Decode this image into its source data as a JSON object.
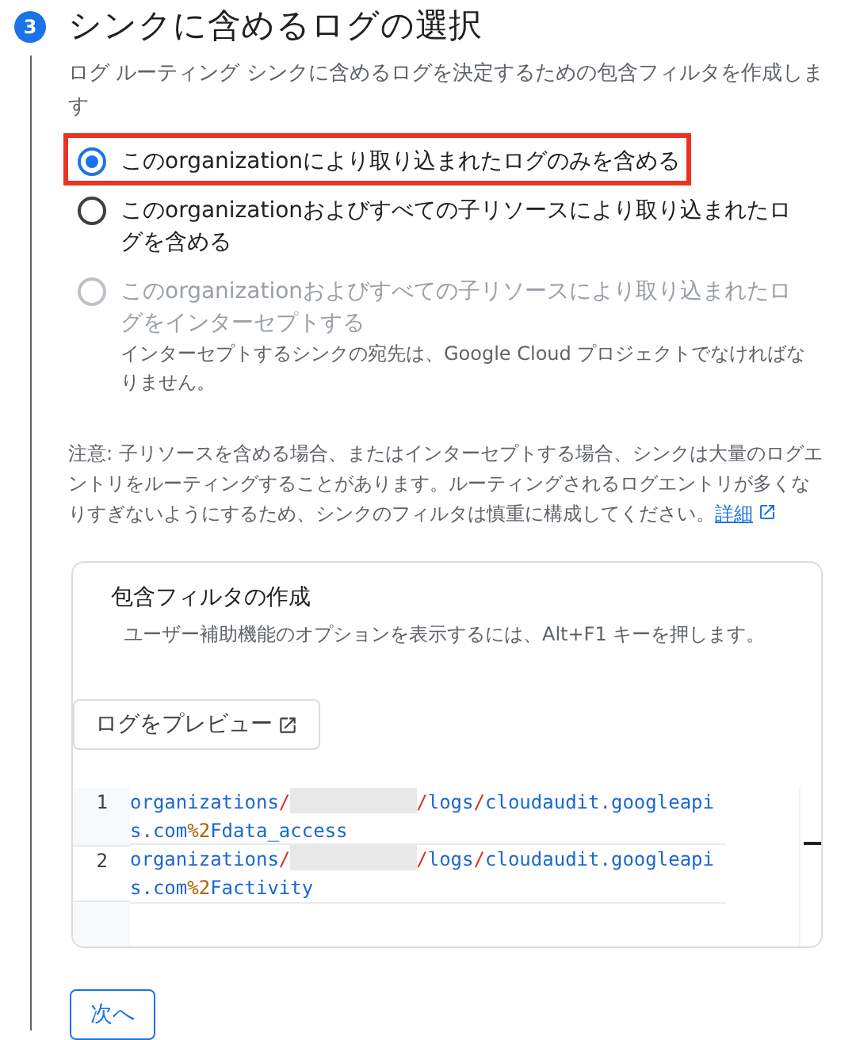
{
  "step": {
    "number": "3",
    "title": "シンクに含めるログの選択",
    "description": "ログ ルーティング シンクに含めるログを決定するための包含フィルタを作成します"
  },
  "options": [
    {
      "label": "このorganizationにより取り込まれたログのみを含める",
      "selected": true,
      "disabled": false,
      "highlighted": true
    },
    {
      "label": "このorganizationおよびすべての子リソースにより取り込まれたログを含める",
      "selected": false,
      "disabled": false,
      "highlighted": false
    },
    {
      "label": "このorganizationおよびすべての子リソースにより取り込まれたログをインターセプトする",
      "selected": false,
      "disabled": true,
      "highlighted": false,
      "hint": "インターセプトするシンクの宛先は、Google Cloud プロジェクトでなければなりません。"
    }
  ],
  "note": {
    "text": "注意: 子リソースを含める場合、またはインターセプトする場合、シンクは大量のログエントリをルーティングすることがあります。ルーティングされるログエントリが多くなりすぎないようにするため、シンクのフィルタは慎重に構成してください。",
    "link": "詳細"
  },
  "filter": {
    "title": "包含フィルタの作成",
    "hint": "ユーザー補助機能のオプションを表示するには、Alt+F1 キーを押します。",
    "preview_button": "ログをプレビュー",
    "lines": [
      {
        "number": "1",
        "selected": false,
        "tokens": [
          {
            "kind": "text",
            "text": "organizations"
          },
          {
            "kind": "op",
            "text": "/"
          },
          {
            "kind": "redacted"
          },
          {
            "kind": "op",
            "text": "/"
          },
          {
            "kind": "text",
            "text": "logs"
          },
          {
            "kind": "op",
            "text": "/"
          },
          {
            "kind": "text",
            "text": "cloudaudit.googleapis.com"
          },
          {
            "kind": "num",
            "text": "%2"
          },
          {
            "kind": "text",
            "text": "Fdata_access"
          }
        ]
      },
      {
        "number": "2",
        "selected": true,
        "tokens": [
          {
            "kind": "text",
            "text": "organizations"
          },
          {
            "kind": "op",
            "text": "/"
          },
          {
            "kind": "redacted"
          },
          {
            "kind": "op",
            "text": "/"
          },
          {
            "kind": "text",
            "text": "logs"
          },
          {
            "kind": "op",
            "text": "/"
          },
          {
            "kind": "text",
            "text": "cloudaudit.googleapis.com"
          },
          {
            "kind": "num",
            "text": "%2"
          },
          {
            "kind": "text",
            "text": "Factivity"
          }
        ]
      }
    ]
  },
  "next_button": "次へ"
}
